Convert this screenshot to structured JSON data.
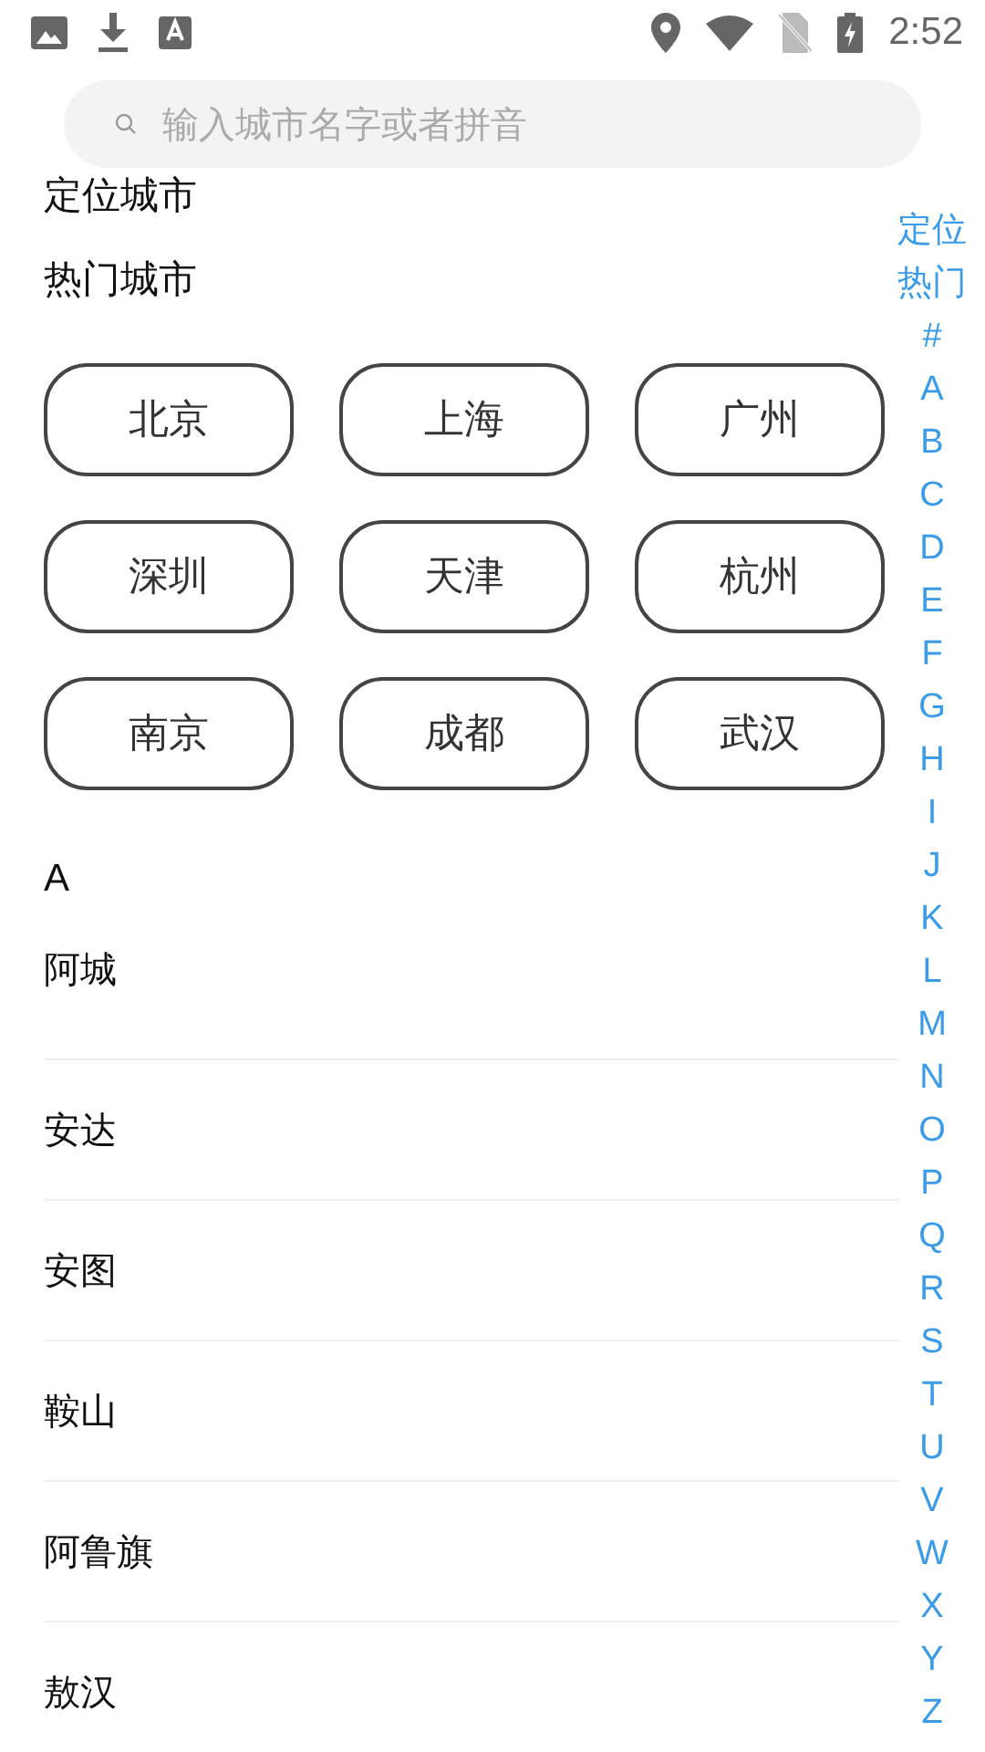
{
  "status_bar": {
    "time": "2:52"
  },
  "search": {
    "placeholder": "输入城市名字或者拼音"
  },
  "located_title": "定位城市",
  "hot_title": "热门城市",
  "hot_cities": [
    "北京",
    "上海",
    "广州",
    "深圳",
    "天津",
    "杭州",
    "南京",
    "成都",
    "武汉"
  ],
  "groups": [
    {
      "letter": "A",
      "cities": [
        "阿城",
        "安达",
        "安图",
        "鞍山",
        "阿鲁旗",
        "敖汉"
      ]
    }
  ],
  "index": [
    "定位",
    "热门",
    "#",
    "A",
    "B",
    "C",
    "D",
    "E",
    "F",
    "G",
    "H",
    "I",
    "J",
    "K",
    "L",
    "M",
    "N",
    "O",
    "P",
    "Q",
    "R",
    "S",
    "T",
    "U",
    "V",
    "W",
    "X",
    "Y",
    "Z"
  ]
}
